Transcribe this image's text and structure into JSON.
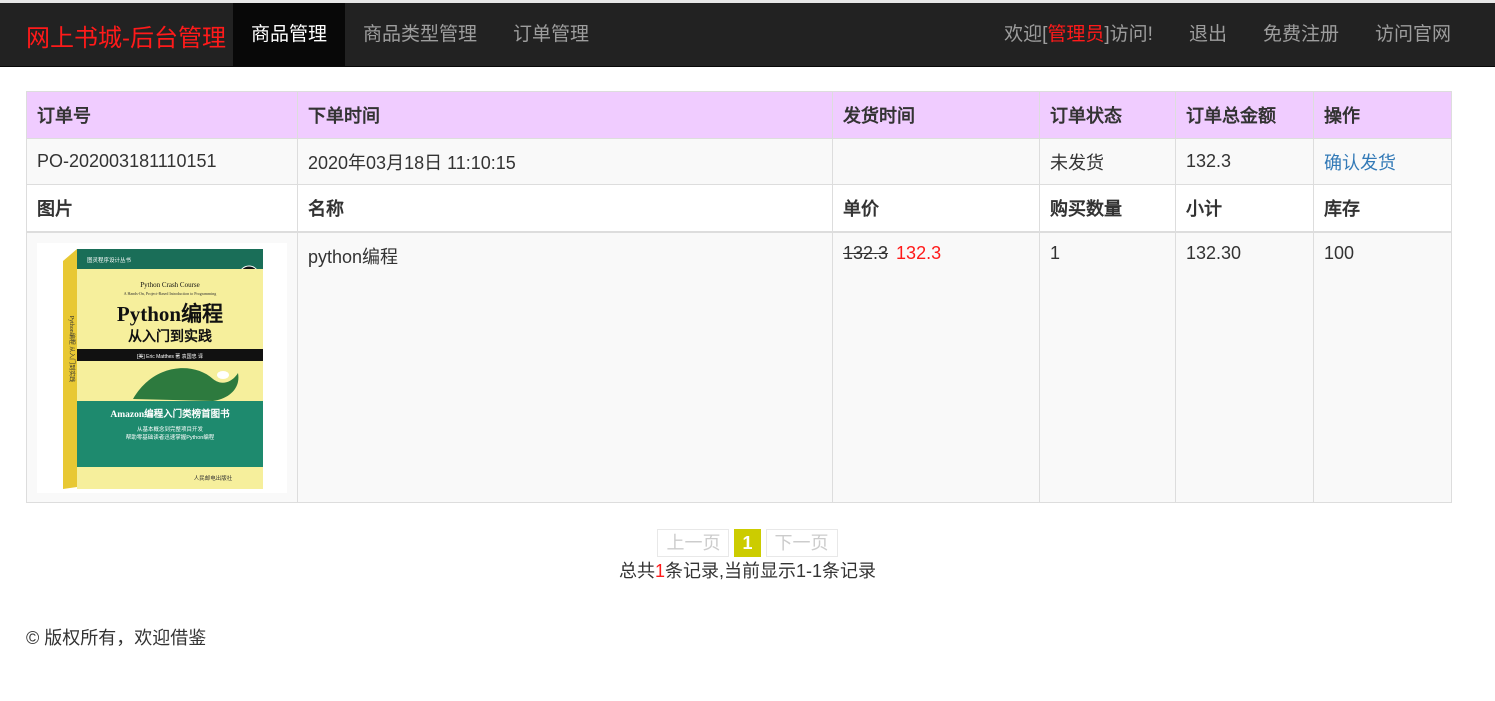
{
  "nav": {
    "brand": "网上书城-后台管理",
    "left_items": [
      "商品管理",
      "商品类型管理",
      "订单管理"
    ],
    "active_index": 0,
    "welcome_prefix": "欢迎[",
    "admin_name": "管理员",
    "welcome_suffix": "]访问!",
    "logout": "退出",
    "register": "免费注册",
    "visit_site": "访问官网"
  },
  "order_table": {
    "headers": [
      "订单号",
      "下单时间",
      "发货时间",
      "订单状态",
      "订单总金额",
      "操作"
    ],
    "order": {
      "order_no": "PO-202003181110151",
      "order_time": "2020年03月18日 11:10:15",
      "ship_time": "",
      "status": "未发货",
      "total": "132.3",
      "action": "确认发货"
    },
    "item_headers": [
      "图片",
      "名称",
      "单价",
      "购买数量",
      "小计",
      "库存"
    ],
    "item": {
      "name": "python编程",
      "old_price": "132.3",
      "new_price": "132.3",
      "quantity": "1",
      "subtotal": "132.30",
      "stock": "100",
      "cover": {
        "series": "图灵程序设计丛书",
        "en_title": "Python Crash Course",
        "en_subtitle": "A Hands-On, Project-Based Introduction to Programming",
        "title": "Python编程",
        "subtitle": "从入门到实践",
        "author": "[美] Eric Matthes 著  袁国忠 译",
        "badge": "Amazon编程入门类榜首图书",
        "tagline1": "从基本概念到完整项目开发",
        "tagline2": "帮助零基础读者迅速掌握Python编程",
        "publisher": "人民邮电出版社",
        "spine": "Python编程 从入门到实践"
      }
    }
  },
  "pager": {
    "prev": "上一页",
    "current": "1",
    "next": "下一页",
    "info_prefix": "总共",
    "info_count": "1",
    "info_suffix": "条记录,当前显示1-1条记录"
  },
  "footer": {
    "text": "© 版权所有，欢迎借鉴"
  },
  "colors": {
    "brand": "#ff1a1a",
    "navbar_bg": "#222222",
    "header_bg": "#f0ccff",
    "link": "#337ab7",
    "pager_current": "#cccc00"
  }
}
